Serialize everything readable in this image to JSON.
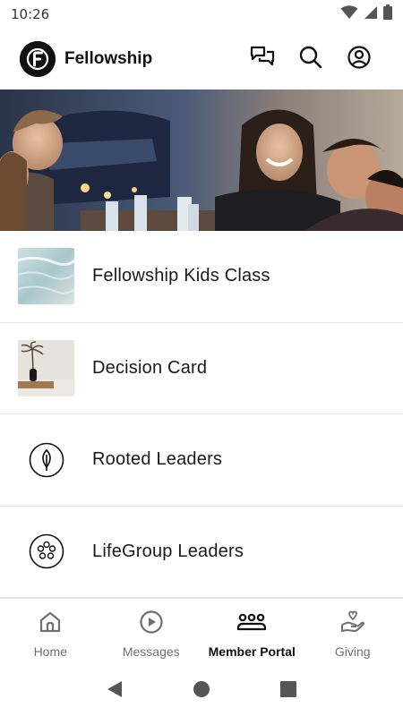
{
  "status_bar": {
    "time": "10:26",
    "icons": [
      "wifi-icon",
      "signal-icon",
      "battery-icon"
    ]
  },
  "app_bar": {
    "logo_letter": "F",
    "title": "Fellowship",
    "actions": [
      "chat-icon",
      "search-icon",
      "account-icon"
    ]
  },
  "list": {
    "items": [
      {
        "label": "Fellowship Kids Class",
        "icon": "water-thumbnail"
      },
      {
        "label": "Decision Card",
        "icon": "vase-thumbnail"
      },
      {
        "label": "Rooted Leaders",
        "icon": "leaf-icon"
      },
      {
        "label": "LifeGroup Leaders",
        "icon": "group-circle-icon"
      }
    ]
  },
  "bottom_nav": {
    "items": [
      {
        "label": "Home",
        "icon": "home-icon",
        "active": false
      },
      {
        "label": "Messages",
        "icon": "play-icon",
        "active": false
      },
      {
        "label": "Member Portal",
        "icon": "people-icon",
        "active": true
      },
      {
        "label": "Giving",
        "icon": "giving-hand-icon",
        "active": false
      }
    ]
  },
  "colors": {
    "text_primary": "#111111",
    "text_secondary": "#6f6f6f",
    "divider": "#e4e4e4"
  }
}
